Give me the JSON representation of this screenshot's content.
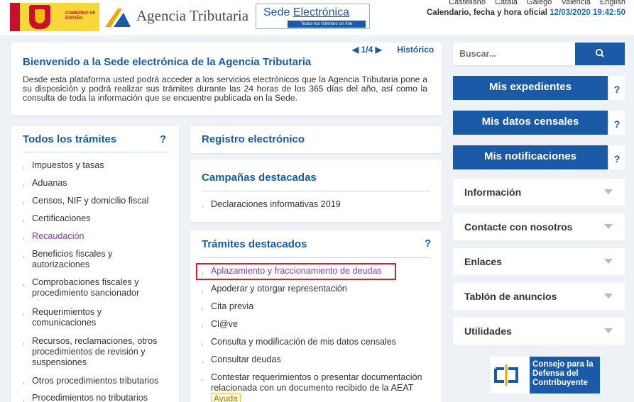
{
  "header": {
    "gov_logo_text": "GOBIERNO DE ESPAÑA",
    "agency_name": "Agencia Tributaria",
    "sede_title_prefix": "Sede",
    "sede_title_main": "Electrónica",
    "sede_subtitle": "Todos los trámites on line",
    "languages": [
      "Castellano",
      "Català",
      "Galego",
      "Valencià",
      "English"
    ],
    "calendar_label": "Calendario, fecha y hora oficial",
    "calendar_datetime": "12/03/2020 19:42:50"
  },
  "welcome": {
    "pager": "1/4",
    "historico": "Histórico",
    "title": "Bienvenido a la Sede electrónica de la Agencia Tributaria",
    "body": "Desde esta plataforma usted podrá acceder a los servicios electrónicos que la Agencia Tributaria pone a su disposición y podrá realizar sus trámites durante las 24 horas de los 365 días del año, así como la consulta de toda la información que se encuentre publicada en la Sede."
  },
  "todos": {
    "title": "Todos los trámites",
    "help": "?",
    "items": [
      "Impuestos y tasas",
      "Aduanas",
      "Censos, NIF y domicilio fiscal",
      "Certificaciones",
      "Recaudación",
      "Beneficios fiscales y autorizaciones",
      "Comprobaciones fiscales y procedimiento sancionador",
      "Requerimientos y comunicaciones",
      "Recursos, reclamaciones, otros procedimientos de revisión y suspensiones",
      "Otros procedimientos tributarios",
      "Procedimientos no tributarios"
    ]
  },
  "registro": {
    "title": "Registro electrónico"
  },
  "campanas": {
    "title": "Campañas destacadas",
    "items": [
      "Declaraciones informativas 2019"
    ]
  },
  "tramites": {
    "title": "Trámites destacados",
    "help": "?",
    "items": [
      "Aplazamiento y fraccionamiento de deudas",
      "Apoderar y otorgar representación",
      "Cita previa",
      "Cl@ve",
      "Consulta y modificación de mis datos censales",
      "Consultar deudas",
      "Contestar requerimientos o presentar documentación relacionada con un documento recibido de la AEAT"
    ],
    "ayuda": "Ayuda"
  },
  "sidebar": {
    "search_placeholder": "Buscar...",
    "buttons": [
      "Mis expedientes",
      "Mis datos censales",
      "Mis notificaciones"
    ],
    "help": "?",
    "accordions": [
      "Información",
      "Contacte con nosotros",
      "Enlaces",
      "Tablón de anuncios",
      "Utilidades"
    ],
    "consejo": [
      "Consejo para la",
      "Defensa del",
      "Contribuyente"
    ]
  },
  "colors": {
    "primary": "#1a5aa6",
    "visited": "#8a3aa0",
    "highlight": "#e0182d",
    "background": "#eef2f6"
  }
}
